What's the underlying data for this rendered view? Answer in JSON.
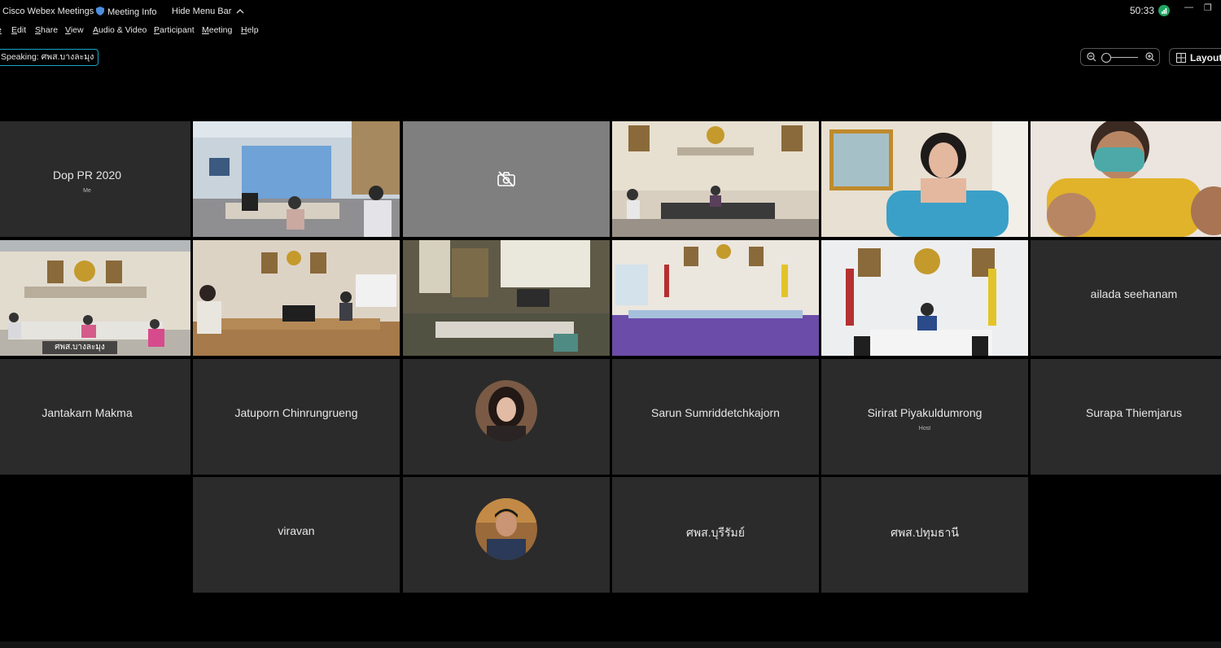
{
  "titlebar": {
    "app_name": "Cisco Webex Meetings",
    "meeting_info": "Meeting Info",
    "hide_menu": "Hide Menu Bar",
    "timer": "50:33"
  },
  "menu": {
    "items": [
      "Edit",
      "Share",
      "View",
      "Audio & Video",
      "Participant",
      "Meeting",
      "Help"
    ]
  },
  "speaking": "Speaking: ศพส.บางละมุง",
  "layout_label": "Layout",
  "colors": {
    "accent": "#1fb6e8",
    "tile_bg": "#2b2b2b",
    "signal": "#1fa463"
  },
  "tiles": [
    {
      "name": "Dop PR 2020",
      "role": "Me"
    },
    {
      "video": "office-two-women"
    },
    {
      "video": "camera-off"
    },
    {
      "video": "meeting-room-emblem"
    },
    {
      "video": "woman-blue-dress"
    },
    {
      "video": "woman-yellow-mask"
    },
    {
      "video": "bang-lamung-room",
      "label": "ศพส.บางละมุง",
      "active": true
    },
    {
      "video": "chiang-mai-room"
    },
    {
      "video": "empty-room"
    },
    {
      "video": "lampang-room"
    },
    {
      "video": "single-person-room"
    },
    {
      "name": "ailada seehanam"
    },
    {
      "name": "Jantakarn Makma"
    },
    {
      "name": "Jatuporn Chinrungrueng"
    },
    {
      "avatar": "woman-avatar"
    },
    {
      "name": "Sarun Sumriddetchkajorn"
    },
    {
      "name": "Sirirat Piyakuldumrong",
      "role": "Host"
    },
    {
      "name": "Surapa Thiemjarus"
    },
    {
      "name": "viravan"
    },
    {
      "avatar": "man-avatar"
    },
    {
      "name": "ศพส.บุรีรัมย์"
    },
    {
      "name": "ศพส.ปทุมธานี"
    }
  ]
}
